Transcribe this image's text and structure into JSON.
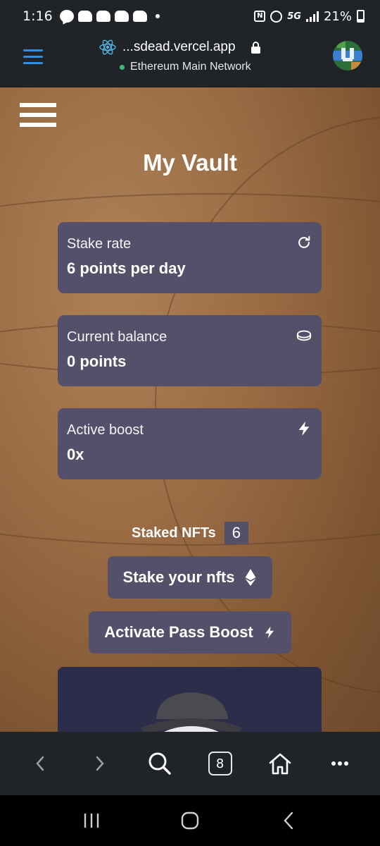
{
  "status_bar": {
    "time": "1:16",
    "network": "5G",
    "battery": "21%"
  },
  "browser": {
    "url": "...sdead.vercel.app",
    "network_status": "Ethereum Main Network",
    "tab_count": "8"
  },
  "vault": {
    "title": "My Vault",
    "stats": [
      {
        "label": "Stake rate",
        "value": "6 points per day",
        "icon": "refresh-icon"
      },
      {
        "label": "Current balance",
        "value": "0 points",
        "icon": "coin-icon"
      },
      {
        "label": "Active boost",
        "value": "0x",
        "icon": "lightning-icon"
      }
    ],
    "staked_label": "Staked NFTs",
    "staked_count": "6",
    "stake_button": "Stake your nfts",
    "boost_button": "Activate Pass Boost"
  },
  "colors": {
    "card": "#55506a",
    "chrome": "#202428",
    "accent": "#2e8fe3",
    "network_dot": "#39c07a"
  }
}
